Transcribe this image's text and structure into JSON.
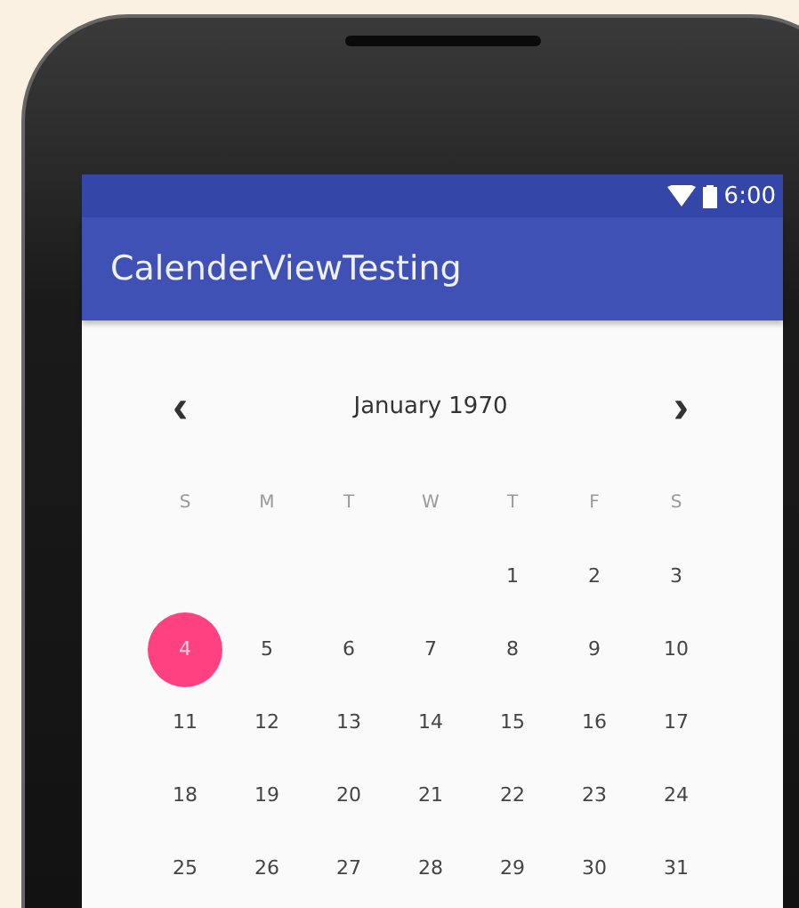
{
  "status_bar": {
    "time": "6:00"
  },
  "app_bar": {
    "title": "CalenderViewTesting"
  },
  "calendar": {
    "prev": "‹",
    "month": "January 1970",
    "next": "›",
    "weekdays": [
      "S",
      "M",
      "T",
      "W",
      "T",
      "F",
      "S"
    ],
    "weeks": [
      [
        {
          "label": "1",
          "selected": false
        },
        {
          "label": "2",
          "selected": false
        },
        {
          "label": "3",
          "selected": false
        }
      ],
      [
        {
          "label": "4",
          "selected": true
        },
        {
          "label": "5",
          "selected": false
        },
        {
          "label": "6",
          "selected": false
        },
        {
          "label": "7",
          "selected": false
        },
        {
          "label": "8",
          "selected": false
        },
        {
          "label": "9",
          "selected": false
        },
        {
          "label": "10",
          "selected": false
        }
      ],
      [
        {
          "label": "11",
          "selected": false
        },
        {
          "label": "12",
          "selected": false
        },
        {
          "label": "13",
          "selected": false
        },
        {
          "label": "14",
          "selected": false
        },
        {
          "label": "15",
          "selected": false
        },
        {
          "label": "16",
          "selected": false
        },
        {
          "label": "17",
          "selected": false
        }
      ],
      [
        {
          "label": "18",
          "selected": false
        },
        {
          "label": "19",
          "selected": false
        },
        {
          "label": "20",
          "selected": false
        },
        {
          "label": "21",
          "selected": false
        },
        {
          "label": "22",
          "selected": false
        },
        {
          "label": "23",
          "selected": false
        },
        {
          "label": "24",
          "selected": false
        }
      ],
      [
        {
          "label": "25",
          "selected": false
        },
        {
          "label": "26",
          "selected": false
        },
        {
          "label": "27",
          "selected": false
        },
        {
          "label": "28",
          "selected": false
        },
        {
          "label": "29",
          "selected": false
        },
        {
          "label": "30",
          "selected": false
        },
        {
          "label": "31",
          "selected": false
        }
      ]
    ]
  }
}
